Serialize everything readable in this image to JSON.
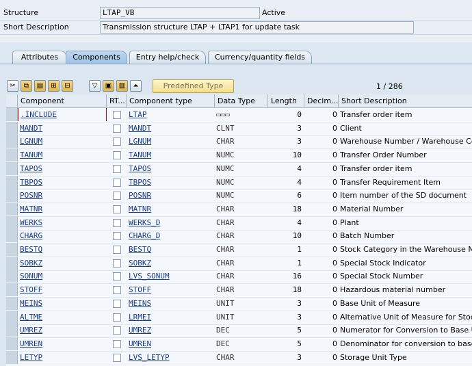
{
  "header": {
    "structure_label": "Structure",
    "structure_value": "LTAP_VB",
    "status": "Active",
    "short_desc_label": "Short Description",
    "short_desc_value": "Transmission structure LTAP + LTAP1 for update task"
  },
  "tabs": [
    {
      "label": "Attributes"
    },
    {
      "label": "Components"
    },
    {
      "label": "Entry help/check"
    },
    {
      "label": "Currency/quantity fields"
    }
  ],
  "toolbar": {
    "predefined_label": "Predefined Type",
    "counter": "1  /  286",
    "icons": [
      "cut-icon",
      "copy-icon",
      "paste-icon",
      "insert-row-icon",
      "delete-row-icon",
      "filter-icon",
      "insert-icon",
      "details-icon",
      "expand-icon"
    ]
  },
  "columns": [
    "Component",
    "RT...",
    "Component type",
    "Data Type",
    "Length",
    "Decim...",
    "Short Description"
  ],
  "rows": [
    {
      "component": ".INCLUDE",
      "ctype": "LTAP",
      "dtype": "▭▭▭",
      "length": "0",
      "dec": "0",
      "desc": "Transfer order item"
    },
    {
      "component": "MANDT",
      "ctype": "MANDT",
      "dtype": "CLNT",
      "length": "3",
      "dec": "0",
      "desc": "Client"
    },
    {
      "component": "LGNUM",
      "ctype": "LGNUM",
      "dtype": "CHAR",
      "length": "3",
      "dec": "0",
      "desc": "Warehouse Number / Warehouse Cor"
    },
    {
      "component": "TANUM",
      "ctype": "TANUM",
      "dtype": "NUMC",
      "length": "10",
      "dec": "0",
      "desc": "Transfer Order Number"
    },
    {
      "component": "TAPOS",
      "ctype": "TAPOS",
      "dtype": "NUMC",
      "length": "4",
      "dec": "0",
      "desc": "Transfer order item"
    },
    {
      "component": "TBPOS",
      "ctype": "TBPOS",
      "dtype": "NUMC",
      "length": "4",
      "dec": "0",
      "desc": "Transfer Requirement Item"
    },
    {
      "component": "POSNR",
      "ctype": "POSNR",
      "dtype": "NUMC",
      "length": "6",
      "dec": "0",
      "desc": "Item number of the SD document"
    },
    {
      "component": "MATNR",
      "ctype": "MATNR",
      "dtype": "CHAR",
      "length": "18",
      "dec": "0",
      "desc": "Material Number"
    },
    {
      "component": "WERKS",
      "ctype": "WERKS_D",
      "dtype": "CHAR",
      "length": "4",
      "dec": "0",
      "desc": "Plant"
    },
    {
      "component": "CHARG",
      "ctype": "CHARG_D",
      "dtype": "CHAR",
      "length": "10",
      "dec": "0",
      "desc": "Batch Number"
    },
    {
      "component": "BESTQ",
      "ctype": "BESTQ",
      "dtype": "CHAR",
      "length": "1",
      "dec": "0",
      "desc": "Stock Category in the Warehouse Ma"
    },
    {
      "component": "SOBKZ",
      "ctype": "SOBKZ",
      "dtype": "CHAR",
      "length": "1",
      "dec": "0",
      "desc": "Special Stock Indicator"
    },
    {
      "component": "SONUM",
      "ctype": "LVS_SONUM",
      "dtype": "CHAR",
      "length": "16",
      "dec": "0",
      "desc": "Special Stock Number"
    },
    {
      "component": "STOFF",
      "ctype": "STOFF",
      "dtype": "CHAR",
      "length": "18",
      "dec": "0",
      "desc": "Hazardous material number"
    },
    {
      "component": "MEINS",
      "ctype": "MEINS",
      "dtype": "UNIT",
      "length": "3",
      "dec": "0",
      "desc": "Base Unit of Measure"
    },
    {
      "component": "ALTME",
      "ctype": "LRMEI",
      "dtype": "UNIT",
      "length": "3",
      "dec": "0",
      "desc": "Alternative Unit of Measure for Stocki"
    },
    {
      "component": "UMREZ",
      "ctype": "UMREZ",
      "dtype": "DEC",
      "length": "5",
      "dec": "0",
      "desc": "Numerator for Conversion to Base Uni"
    },
    {
      "component": "UMREN",
      "ctype": "UMREN",
      "dtype": "DEC",
      "length": "5",
      "dec": "0",
      "desc": "Denominator for conversion to base u"
    },
    {
      "component": "LETYP",
      "ctype": "LVS_LETYP",
      "dtype": "CHAR",
      "length": "3",
      "dec": "0",
      "desc": "Storage Unit Type"
    }
  ]
}
